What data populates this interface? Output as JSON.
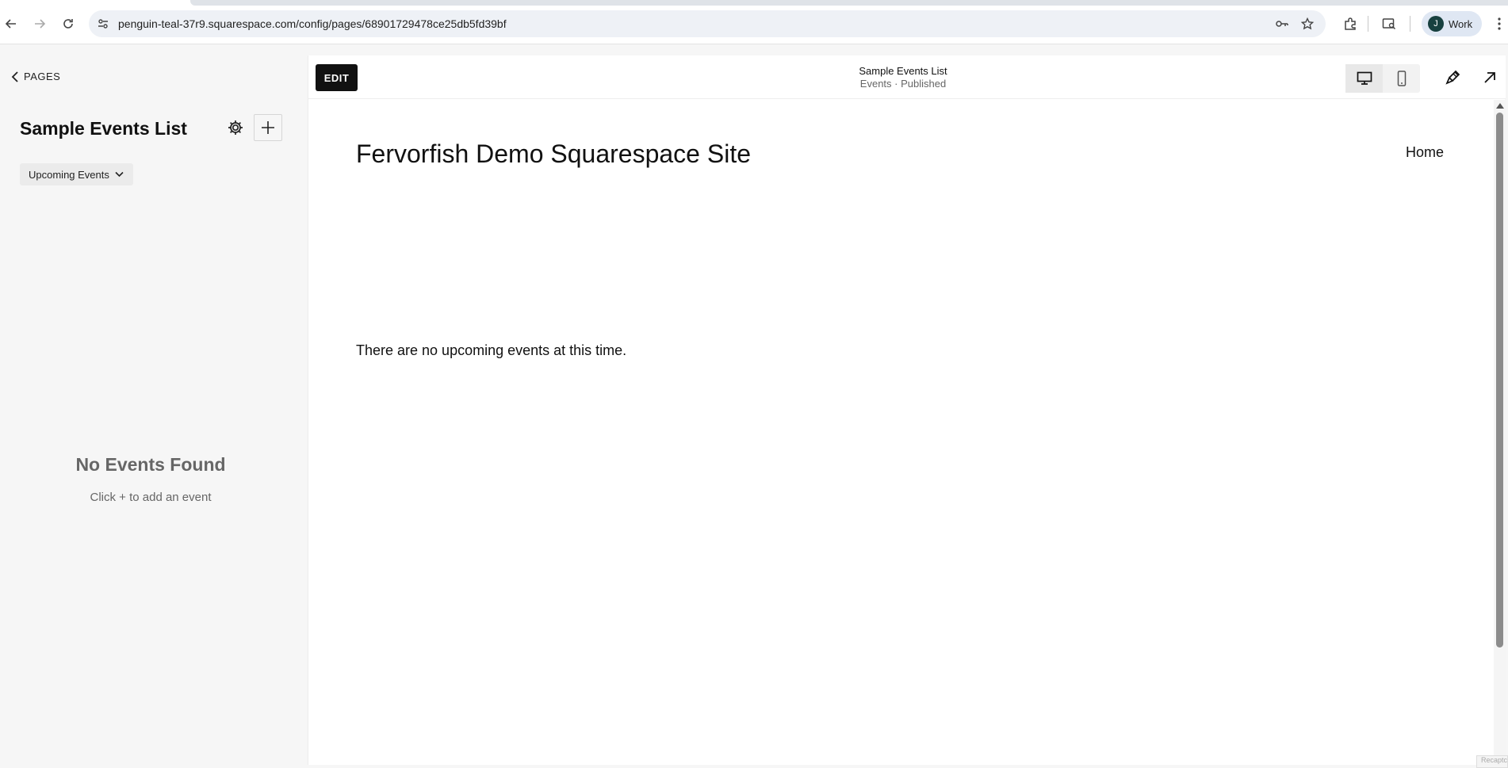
{
  "browser": {
    "url": "penguin-teal-37r9.squarespace.com/config/pages/68901729478ce25db5fd39bf",
    "profile_initial": "J",
    "profile_name": "Work"
  },
  "left_panel": {
    "back_label": "PAGES",
    "page_title": "Sample Events List",
    "filter_label": "Upcoming Events",
    "empty_title": "No Events Found",
    "empty_hint": "Click + to add an event"
  },
  "preview": {
    "edit_label": "EDIT",
    "page_name": "Sample Events List",
    "page_status": "Events · Published",
    "active_device": "desktop",
    "site": {
      "title": "Fervorfish Demo Squarespace Site",
      "nav_home": "Home",
      "no_events_text": "There are no upcoming events at this time."
    },
    "recaptcha_text": "Recaptcha"
  },
  "colors": {
    "accent_dark": "#111111",
    "panel_bg": "#f6f6f6",
    "muted_text": "#666666"
  }
}
